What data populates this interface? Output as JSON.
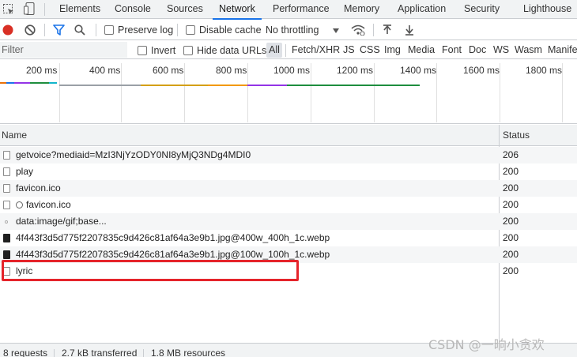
{
  "tabs": {
    "elements": "Elements",
    "console": "Console",
    "sources": "Sources",
    "network": "Network",
    "performance": "Performance",
    "memory": "Memory",
    "application": "Application",
    "security": "Security",
    "lighthouse": "Lighthouse",
    "active": "network"
  },
  "toolbar": {
    "preserve_log": "Preserve log",
    "disable_cache": "Disable cache",
    "throttling": "No throttling"
  },
  "filter": {
    "placeholder": "Filter",
    "invert": "Invert",
    "hide_data_urls": "Hide data URLs",
    "types": [
      "All",
      "Fetch/XHR",
      "JS",
      "CSS",
      "Img",
      "Media",
      "Font",
      "Doc",
      "WS",
      "Wasm",
      "Manife"
    ]
  },
  "overview": {
    "ticks": [
      "200 ms",
      "400 ms",
      "600 ms",
      "800 ms",
      "1000 ms",
      "1200 ms",
      "1400 ms",
      "1600 ms",
      "1800 ms"
    ]
  },
  "grid": {
    "col_name": "Name",
    "col_status": "Status",
    "rows": [
      {
        "name": "getvoice?mediaid=MzI3NjYzODY0NI8yMjQ3NDg4MDI0",
        "status": "206"
      },
      {
        "name": "play",
        "status": "200"
      },
      {
        "name": "favicon.ico",
        "status": "200"
      },
      {
        "name": "favicon.ico",
        "status": "200"
      },
      {
        "name": "data:image/gif;base...",
        "status": "200"
      },
      {
        "name": "4f443f3d5d775f2207835c9d426c81af64a3e9b1.jpg@400w_400h_1c.webp",
        "status": "200"
      },
      {
        "name": "4f443f3d5d775f2207835c9d426c81af64a3e9b1.jpg@100w_100h_1c.webp",
        "status": "200"
      },
      {
        "name": "lyric",
        "status": "200"
      }
    ]
  },
  "statusbar": {
    "requests": "8 requests",
    "transferred": "2.7 kB transferred",
    "resources": "1.8 MB resources"
  },
  "watermark": "CSDN @一晌小贪欢",
  "colors": {
    "accent": "#1a73e8",
    "record": "#d93025",
    "highlight": "#e5242b"
  }
}
